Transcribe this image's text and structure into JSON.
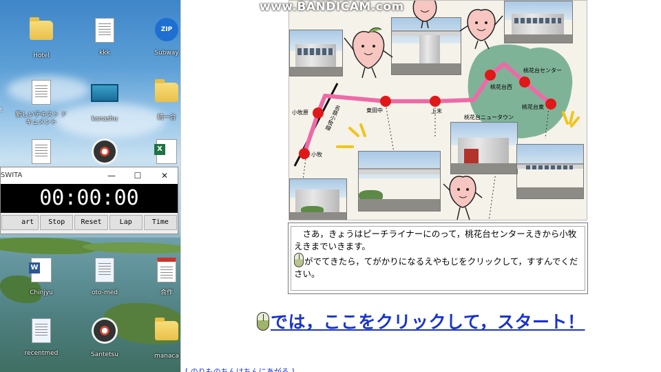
{
  "watermark": "www.BANDICAM.com",
  "desktop": {
    "icons": [
      {
        "label": "Hotel"
      },
      {
        "label": "kkk"
      },
      {
        "label": "Subway",
        "badge": "ZIP"
      },
      {
        "label": "新しいテキスト ドキュメント"
      },
      {
        "label": "kanashu"
      },
      {
        "label": "統一合"
      },
      {
        "label": "Chinjyu",
        "badge": "W"
      },
      {
        "label": "oto-med"
      },
      {
        "label": "合作"
      },
      {
        "label": "recentmed"
      },
      {
        "label": "Santetsu"
      },
      {
        "label": "manaca"
      }
    ],
    "partial_left_label": "t"
  },
  "stopwatch": {
    "title": "SWITA",
    "time": "00:00:00",
    "buttons": [
      "art",
      "Stop",
      "Reset",
      "Lap",
      "Time"
    ],
    "window_controls": [
      "—",
      "☐",
      "✕"
    ]
  },
  "map": {
    "stations": [
      {
        "label": "小牧原"
      },
      {
        "label": "東田中"
      },
      {
        "label": "上末"
      },
      {
        "label": "桃花台西"
      },
      {
        "label": "桃花台センター"
      },
      {
        "label": "桃花台東"
      },
      {
        "label": "小牧"
      }
    ],
    "newtown_label": "桃花台ニュータウン",
    "railway_label": "名鉄小牧線",
    "colors": {
      "line": "#ee6aa7",
      "station": "#e01818",
      "area": "#6aa88a"
    }
  },
  "description": {
    "line1": "さあ，きょうはピーチライナーにのって，桃花台センターえきから小牧えきまでいきます。",
    "line2": "がでてきたら，てがかりになるえやもじをクリックして，すすんでください。"
  },
  "start_link": "では，ここをクリックして，スタート！",
  "bottom_link": "[ のりものちんはちんにあがろ ]"
}
